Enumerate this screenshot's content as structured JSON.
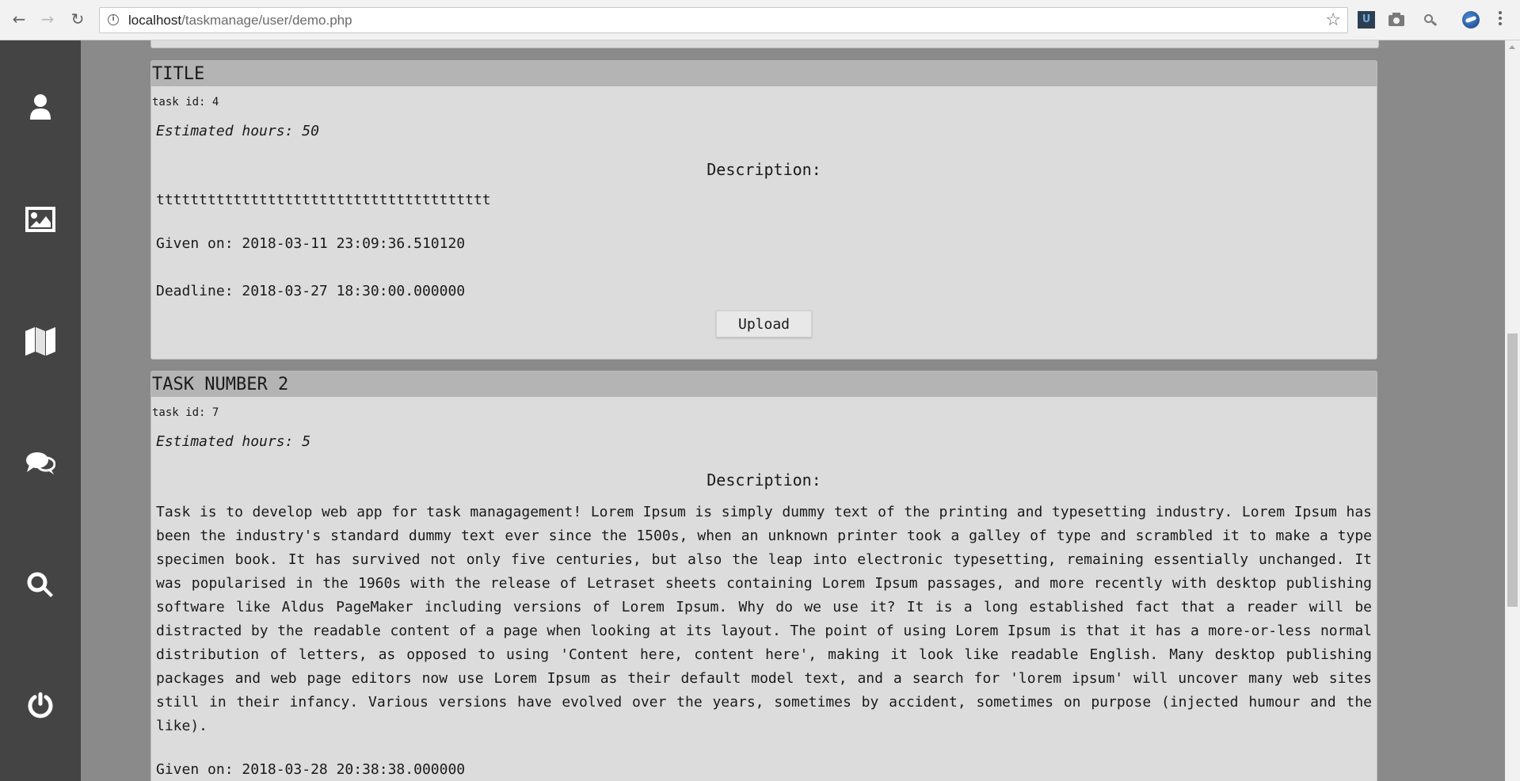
{
  "browser": {
    "url_host": "localhost",
    "url_path": "/taskmanage/user/demo.php",
    "nav": {
      "back": "←",
      "forward": "→",
      "reload": "↻"
    },
    "info_icon": "i",
    "star": "☆",
    "extensions": [
      "udemy-extension-icon",
      "camera-icon",
      "search-extension-icon",
      "globe-extension-icon"
    ]
  },
  "sidebar": {
    "items": [
      {
        "icon": "user-icon"
      },
      {
        "icon": "image-icon"
      },
      {
        "icon": "map-icon"
      },
      {
        "icon": "chat-icon"
      },
      {
        "icon": "search-icon"
      },
      {
        "icon": "power-icon"
      }
    ]
  },
  "tasks": [
    {
      "title": "TITLE",
      "task_id": "task id: 4",
      "estimated": "Estimated hours: 50",
      "description_label": "Description:",
      "description": "ttttttttttttttttttttttttttttttttttttttt",
      "given_on": "Given on: 2018-03-11 23:09:36.510120",
      "deadline": "Deadline: 2018-03-27 18:30:00.000000",
      "upload_label": "Upload"
    },
    {
      "title": "TASK NUMBER 2",
      "task_id": "task id: 7",
      "estimated": "Estimated hours: 5",
      "description_label": "Description:",
      "description": "Task is to develop web app for task managagement! Lorem Ipsum is simply dummy text of the printing and typesetting industry. Lorem Ipsum has been the industry's standard dummy text ever since the 1500s, when an unknown printer took a galley of type and scrambled it to make a type specimen book. It has survived not only five centuries, but also the leap into electronic typesetting, remaining essentially unchanged. It was popularised in the 1960s with the release of Letraset sheets containing Lorem Ipsum passages, and more recently with desktop publishing software like Aldus PageMaker including versions of Lorem Ipsum. Why do we use it? It is a long established fact that a reader will be distracted by the readable content of a page when looking at its layout. The point of using Lorem Ipsum is that it has a more-or-less normal distribution of letters, as opposed to using 'Content here, content here', making it look like readable English. Many desktop publishing packages and web page editors now use Lorem Ipsum as their default model text, and a search for 'lorem ipsum' will uncover many web sites still in their infancy. Various versions have evolved over the years, sometimes by accident, sometimes on purpose (injected humour and the like).",
      "given_on": "Given on: 2018-03-28 20:38:38.000000"
    }
  ]
}
